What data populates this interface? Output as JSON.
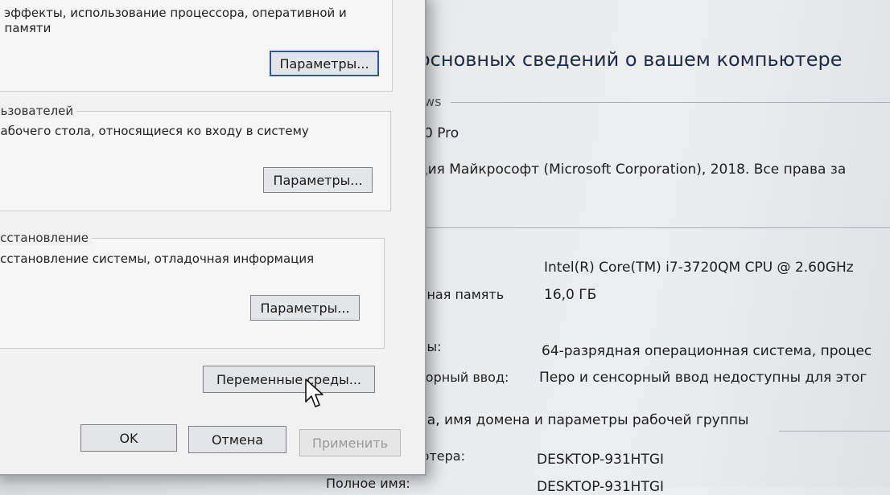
{
  "background": {
    "title": "основных сведений о вашем компьютере",
    "edition_section": "ws",
    "edition_value": "0 Pro",
    "copyright": "ция Майкрософт (Microsoft Corporation), 2018. Все права за",
    "system_rows": [
      {
        "label": ":",
        "value": "Intel(R) Core(TM) i7-3720QM CPU @ 2.60GHz"
      },
      {
        "label": "нная память",
        "value": "16,0 ГБ"
      },
      {
        "label": "ны:",
        "value": "64-разрядная операционная система, процес"
      },
      {
        "label": "сорный ввод:",
        "value": "Перо и сенсорный ввод недоступны для этог"
      }
    ],
    "name_section": "ра, имя домена и параметры рабочей группы",
    "computer_name_label": "ютера:",
    "computer_name_value": "DESKTOP-931HTGI",
    "full_name_label": "Полное имя:",
    "full_name_value": "DESKTOP-931HTGI"
  },
  "dialog": {
    "performance": {
      "desc_line1": "е эффекты, использование процессора, оперативной и",
      "desc_line2": "й памяти",
      "button": "Параметры..."
    },
    "profiles": {
      "title": "льзователей",
      "desc": "рабочего стола, относящиеся ко входу в систему",
      "button": "Параметры..."
    },
    "recovery": {
      "title": "осстановление",
      "desc": "осстановление системы, отладочная информация",
      "button": "Параметры..."
    },
    "env_button": "Переменные среды...",
    "ok": "OK",
    "cancel": "Отмена",
    "apply": "Применить"
  },
  "colors": {
    "focus_border": "#2a55b8",
    "dialog_bg": "#f1f1f1"
  },
  "icons": {
    "cursor": "arrow-cursor-icon"
  }
}
